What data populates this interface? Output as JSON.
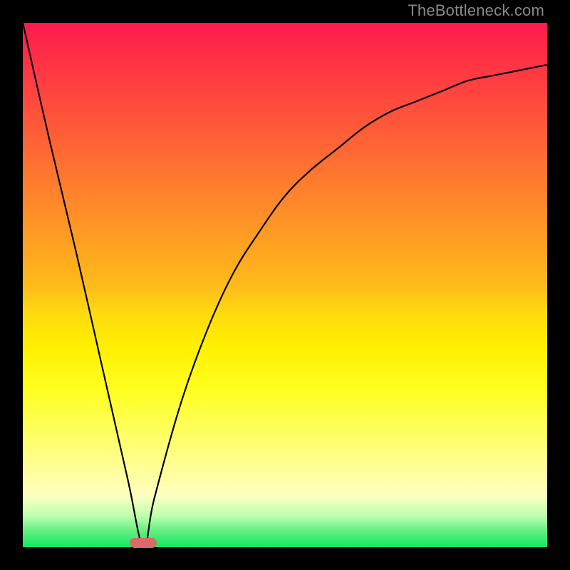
{
  "watermark": "TheBottleneck.com",
  "chart_data": {
    "type": "line",
    "title": "",
    "xlabel": "",
    "ylabel": "",
    "xlim": [
      0,
      100
    ],
    "ylim": [
      0,
      100
    ],
    "grid": false,
    "legend": false,
    "minimum_x": 23,
    "series": [
      {
        "name": "left-branch",
        "x": [
          0,
          5,
          10,
          15,
          20,
          23
        ],
        "values": [
          100,
          78,
          57,
          35,
          13,
          0
        ]
      },
      {
        "name": "right-branch",
        "x": [
          23,
          25,
          30,
          35,
          40,
          45,
          50,
          55,
          60,
          65,
          70,
          75,
          80,
          85,
          90,
          95,
          100
        ],
        "values": [
          0,
          9,
          27,
          41,
          52,
          60,
          67,
          72,
          76,
          80,
          83,
          85,
          87,
          89,
          90,
          91,
          92
        ]
      }
    ],
    "gradient_stops": [
      {
        "pos": 0,
        "color": "#ff1a4d"
      },
      {
        "pos": 50,
        "color": "#ffba1a"
      },
      {
        "pos": 70,
        "color": "#ffff20"
      },
      {
        "pos": 100,
        "color": "#10e860"
      }
    ],
    "marker": {
      "x": 23,
      "color": "#d86a6a"
    }
  }
}
